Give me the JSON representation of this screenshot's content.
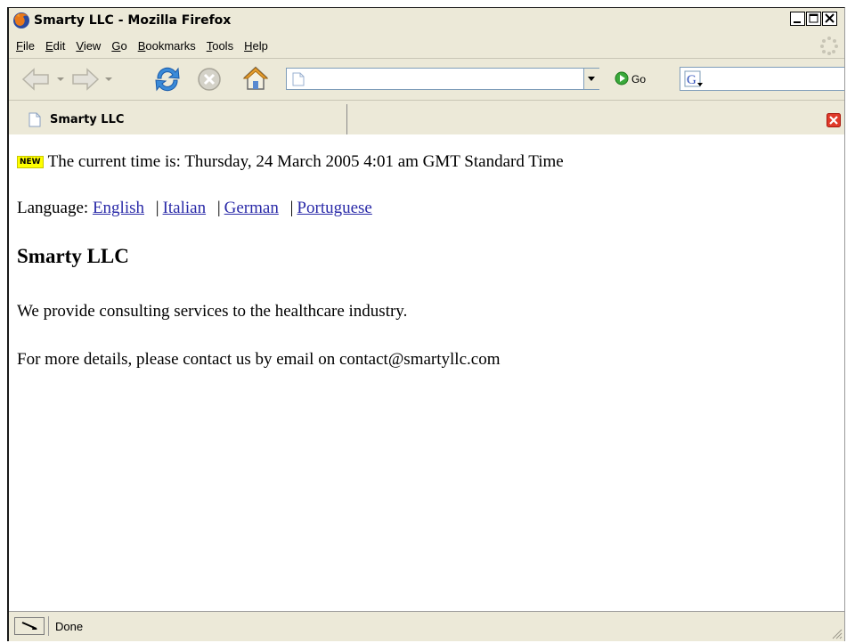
{
  "window": {
    "title": "Smarty LLC - Mozilla Firefox",
    "app_icon": "firefox-icon"
  },
  "menu": {
    "items": [
      {
        "label": "File",
        "underline": "F"
      },
      {
        "label": "Edit",
        "underline": "E"
      },
      {
        "label": "View",
        "underline": "V"
      },
      {
        "label": "Go",
        "underline": "G"
      },
      {
        "label": "Bookmarks",
        "underline": "B"
      },
      {
        "label": "Tools",
        "underline": "T"
      },
      {
        "label": "Help",
        "underline": "H"
      }
    ]
  },
  "navbar": {
    "url_value": "",
    "go_label": "Go",
    "search_engine_icon": "google-icon"
  },
  "tab": {
    "label": "Smarty LLC"
  },
  "content": {
    "new_badge": "NEW",
    "time_text": "The current time is: Thursday, 24 March 2005 4:01 am GMT Standard Time",
    "language_label": "Language:",
    "languages": [
      "English",
      "Italian",
      "German",
      "Portuguese"
    ],
    "separator": "|",
    "heading": "Smarty LLC",
    "paragraph1": "We provide consulting services to the healthcare industry.",
    "paragraph2": "For more details, please contact us by email on contact@smartyllc.com"
  },
  "status": {
    "text": "Done"
  },
  "colors": {
    "chrome": "#ece9d8",
    "link": "#2a2aa8",
    "new_badge": "#ffff00",
    "tab_close": "#e03a2a"
  }
}
